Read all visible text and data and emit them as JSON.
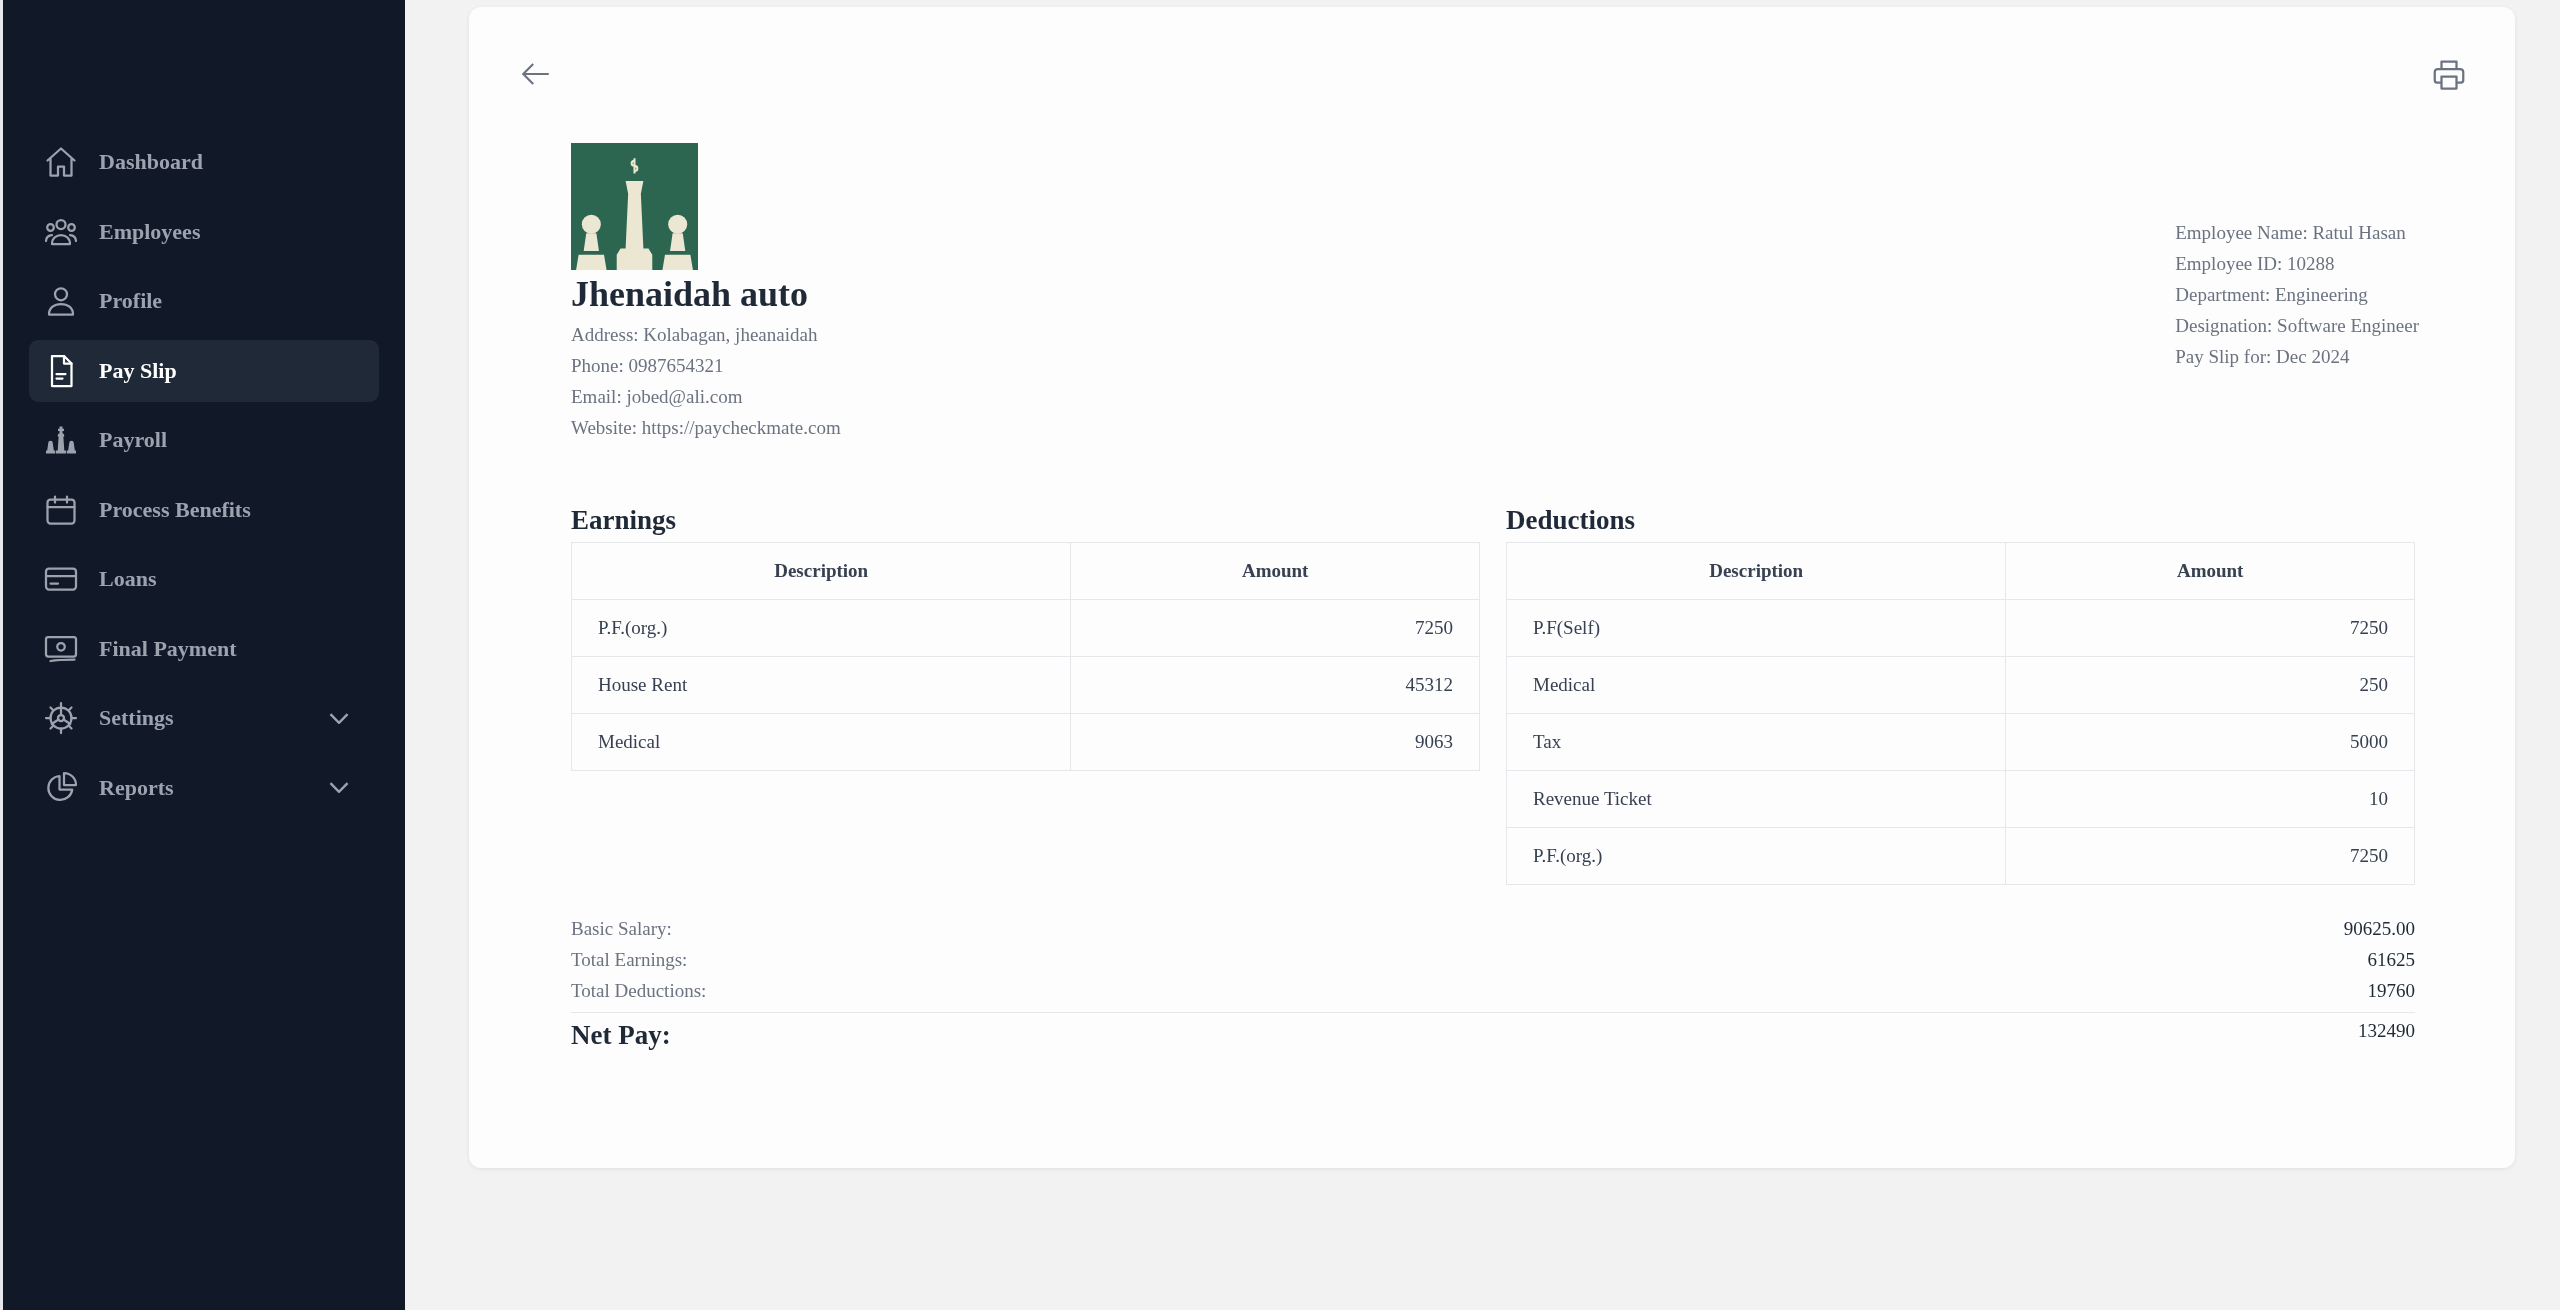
{
  "sidebar": {
    "items": [
      {
        "label": "Dashboard",
        "selected": false,
        "expandable": false
      },
      {
        "label": "Employees",
        "selected": false,
        "expandable": false
      },
      {
        "label": "Profile",
        "selected": false,
        "expandable": false
      },
      {
        "label": "Pay Slip",
        "selected": true,
        "expandable": false
      },
      {
        "label": "Payroll",
        "selected": false,
        "expandable": false
      },
      {
        "label": "Process Benefits",
        "selected": false,
        "expandable": false
      },
      {
        "label": "Loans",
        "selected": false,
        "expandable": false
      },
      {
        "label": "Final Payment",
        "selected": false,
        "expandable": false
      },
      {
        "label": "Settings",
        "selected": false,
        "expandable": true
      },
      {
        "label": "Reports",
        "selected": false,
        "expandable": true
      }
    ]
  },
  "company": {
    "name": "Jhenaidah auto",
    "details": [
      "Address: Kolabagan, jheanaidah",
      "Phone: 0987654321",
      "Email: jobed@ali.com",
      "Website: https://paycheckmate.com"
    ]
  },
  "employee": [
    "Employee Name: Ratul Hasan",
    "Employee ID: 10288",
    "Department: Engineering",
    "Designation: Software Engineer",
    "Pay Slip for: Dec 2024"
  ],
  "tables": [
    {
      "title": "Earnings",
      "columns": [
        "Description",
        "Amount"
      ],
      "rows": [
        [
          "P.F.(org.)",
          "7250"
        ],
        [
          "House Rent",
          "45312"
        ],
        [
          "Medical",
          "9063"
        ]
      ]
    },
    {
      "title": "Deductions",
      "columns": [
        "Description",
        "Amount"
      ],
      "rows": [
        [
          "P.F(Self)",
          "7250"
        ],
        [
          "Medical",
          "250"
        ],
        [
          "Tax",
          "5000"
        ],
        [
          "Revenue Ticket",
          "10"
        ],
        [
          "P.F.(org.)",
          "7250"
        ]
      ]
    }
  ],
  "summary": [
    {
      "label": "Basic Salary:",
      "value": "90625.00"
    },
    {
      "label": "Total Earnings:",
      "value": "61625"
    },
    {
      "label": "Total Deductions:",
      "value": "19760"
    }
  ],
  "net_pay": {
    "label": "Net Pay:",
    "value": "132490"
  }
}
